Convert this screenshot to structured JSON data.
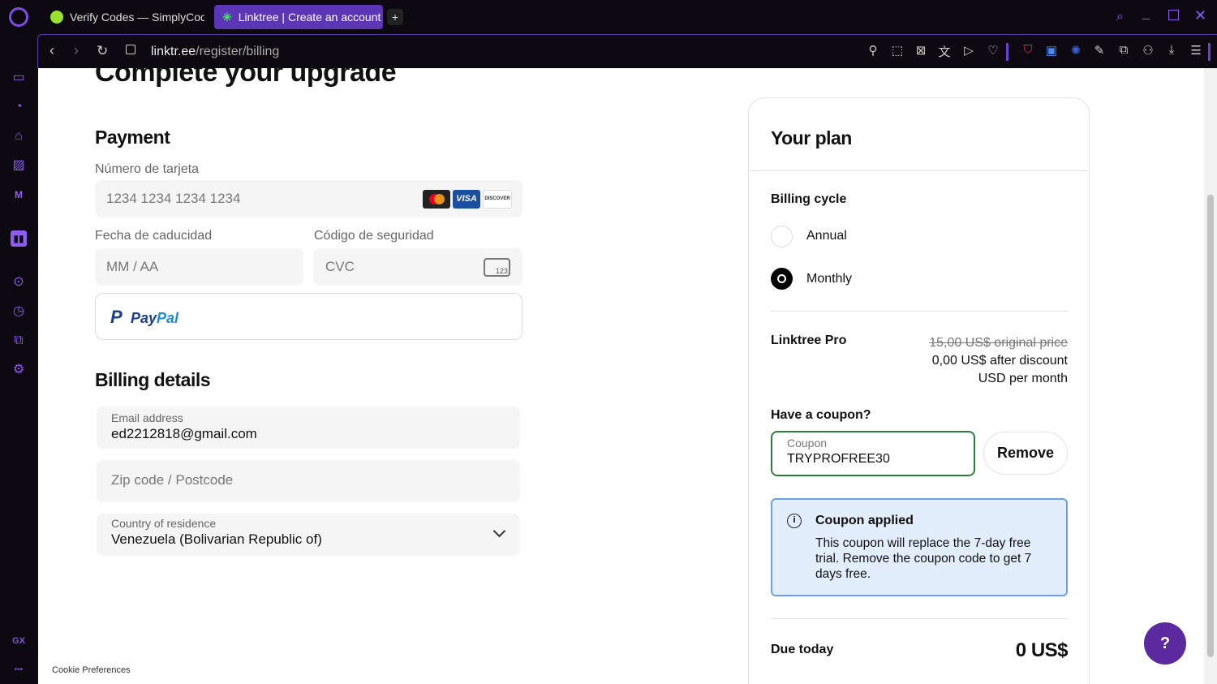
{
  "browser": {
    "tabs": [
      {
        "label": "Verify Codes — SimplyCodes"
      },
      {
        "label": "Linktree | Create an account"
      }
    ],
    "new_tab": "+",
    "url_domain": "linktr.ee",
    "url_path": "/register/billing",
    "sidebar_label": "GX",
    "sidebar_more": "•••"
  },
  "page": {
    "title": "Complete your upgrade",
    "payment": {
      "heading": "Payment",
      "card_label": "Número de tarjeta",
      "card_placeholder": "1234 1234 1234 1234",
      "brands": [
        "VISA",
        "DISCOVER"
      ],
      "expiry_label": "Fecha de caducidad",
      "expiry_placeholder": "MM / AA",
      "cvc_label": "Código de seguridad",
      "cvc_placeholder": "CVC",
      "cvc_icon_text": "123",
      "paypal_a": "Pay",
      "paypal_b": "Pal"
    },
    "billing": {
      "heading": "Billing details",
      "email_label": "Email address",
      "email_value": "ed2212818@gmail.com",
      "zip_placeholder": "Zip code / Postcode",
      "country_label": "Country of residence",
      "country_value": "Venezuela (Bolivarian Republic of)"
    },
    "cookie": "Cookie Preferences",
    "plan": {
      "heading": "Your plan",
      "cycle_label": "Billing cycle",
      "options": [
        {
          "label": "Annual",
          "selected": false
        },
        {
          "label": "Monthly",
          "selected": true
        }
      ],
      "product": "Linktree Pro",
      "original_price": "15,00 US$ original price",
      "discount_price": "0,00 US$ after discount",
      "period": "USD per month",
      "coupon_heading": "Have a coupon?",
      "coupon_label": "Coupon",
      "coupon_value": "TRYPROFREE30",
      "remove": "Remove",
      "notice_title": "Coupon applied",
      "notice_body": "This coupon will replace the 7-day free trial. Remove the coupon code to get 7 days free.",
      "due_label": "Due today",
      "due_value": "0 US$"
    }
  }
}
